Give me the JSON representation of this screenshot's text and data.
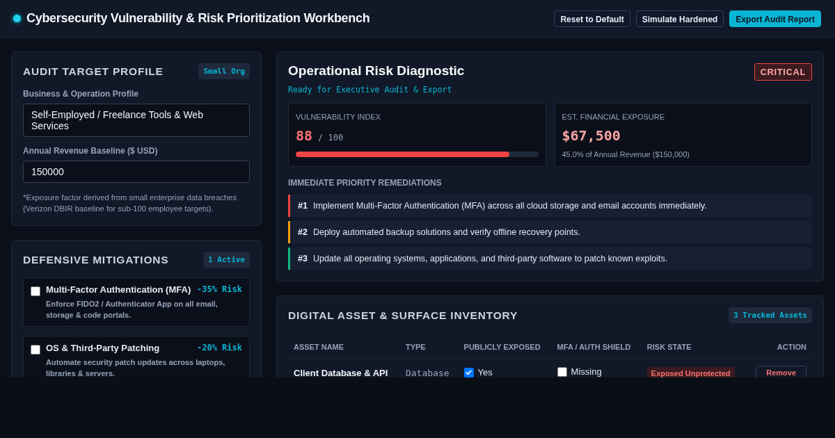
{
  "header": {
    "title": "Cybersecurity Vulnerability & Risk Prioritization Workbench",
    "buttons": [
      {
        "label": "Reset to Default",
        "kind": "outline"
      },
      {
        "label": "Simulate Hardened",
        "kind": "outline"
      },
      {
        "label": "Export Audit Report",
        "kind": "primary"
      }
    ]
  },
  "profile": {
    "title": "AUDIT TARGET PROFILE",
    "badge": "Small Org",
    "fields": [
      {
        "label": "Business & Operation Profile",
        "value": "Self-Employed / Freelance Tools & Web Services"
      },
      {
        "label": "Annual Revenue Baseline ($ USD)",
        "value": "150000"
      }
    ],
    "note": "*Exposure factor derived from small enterprise data breaches (Verizon DBIR baseline for sub-100 employee targets)."
  },
  "mitigations": {
    "title": "DEFENSIVE MITIGATIONS",
    "badge": "1 Active",
    "items": [
      {
        "name": "Multi-Factor Authentication (MFA)",
        "impact": "-35% Risk",
        "description": "Enforce FIDO2 / Authenticator App on all email, storage & code portals.",
        "checked": false
      },
      {
        "name": "OS & Third-Party Patching",
        "impact": "-20% Risk",
        "description": "Automate security patch updates across laptops, libraries & servers.",
        "checked": false
      }
    ]
  },
  "diagnostic": {
    "title": "Operational Risk Diagnostic",
    "subtitle": "Ready for Executive Audit & Export",
    "severity": "CRITICAL",
    "index": {
      "label": "VULNERABILITY INDEX",
      "value": "88",
      "max": "/ 100",
      "level": 0.88
    },
    "exposure": {
      "label": "EST. FINANCIAL EXPOSURE",
      "value": "$67,500",
      "note": "45.0% of Annual Revenue ($150,000)"
    },
    "remediations_title": "IMMEDIATE PRIORITY REMEDIATIONS",
    "remediations": [
      {
        "rank": "#1",
        "text": "Implement Multi-Factor Authentication (MFA) across all cloud storage and email accounts immediately.",
        "color": "#ef4444"
      },
      {
        "rank": "#2",
        "text": "Deploy automated backup solutions and verify offline recovery points.",
        "color": "#f59e0b"
      },
      {
        "rank": "#3",
        "text": "Update all operating systems, applications, and third-party software to patch known exploits.",
        "color": "#10b981"
      }
    ]
  },
  "inventory": {
    "title": "DIGITAL ASSET & SURFACE INVENTORY",
    "badge": "3 Tracked Assets",
    "columns": [
      "ASSET NAME",
      "TYPE",
      "PUBLICLY EXPOSED",
      "MFA / AUTH SHIELD",
      "RISK STATE",
      "ACTION"
    ],
    "rows": [
      {
        "name": "Client Database & API",
        "type": "Database",
        "exposed": true,
        "exposed_label": "Yes",
        "mfa": false,
        "mfa_label": "Missing",
        "risk": "Exposed Unprotected",
        "action": "Remove"
      }
    ]
  }
}
